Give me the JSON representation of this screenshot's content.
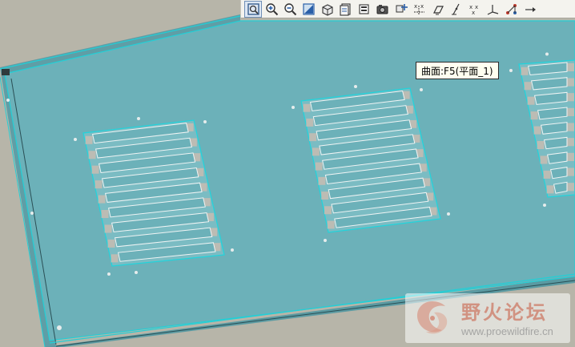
{
  "viewport": {
    "background_color": "#b7b5a9",
    "plate_color": "#6cb1b9",
    "edge_color": "#2bd3d9"
  },
  "toolbar": {
    "buttons": [
      {
        "name": "zoom-fit-icon",
        "active": true
      },
      {
        "name": "zoom-in-icon",
        "active": false
      },
      {
        "name": "zoom-out-icon",
        "active": false
      },
      {
        "name": "repaint-icon",
        "active": false
      },
      {
        "name": "view-orientation-icon",
        "active": false
      },
      {
        "name": "saved-views-icon",
        "active": false
      },
      {
        "name": "layers-icon",
        "active": false
      },
      {
        "name": "display-style-icon",
        "active": false
      },
      {
        "name": "spin-center-icon",
        "active": false
      },
      {
        "name": "datum-axes-icon",
        "active": false
      },
      {
        "name": "datum-planes-icon",
        "active": false
      },
      {
        "name": "datum-axis-icon",
        "active": false
      },
      {
        "name": "datum-points-icon",
        "active": false
      },
      {
        "name": "coordinate-system-icon",
        "active": false
      },
      {
        "name": "annotation-icon",
        "active": false
      },
      {
        "name": "more-icon",
        "active": false
      }
    ]
  },
  "tooltip": {
    "text": "曲面:F5(平面_1)"
  },
  "watermark": {
    "title": "野火论坛",
    "url": "www.proewildfire.cn"
  }
}
